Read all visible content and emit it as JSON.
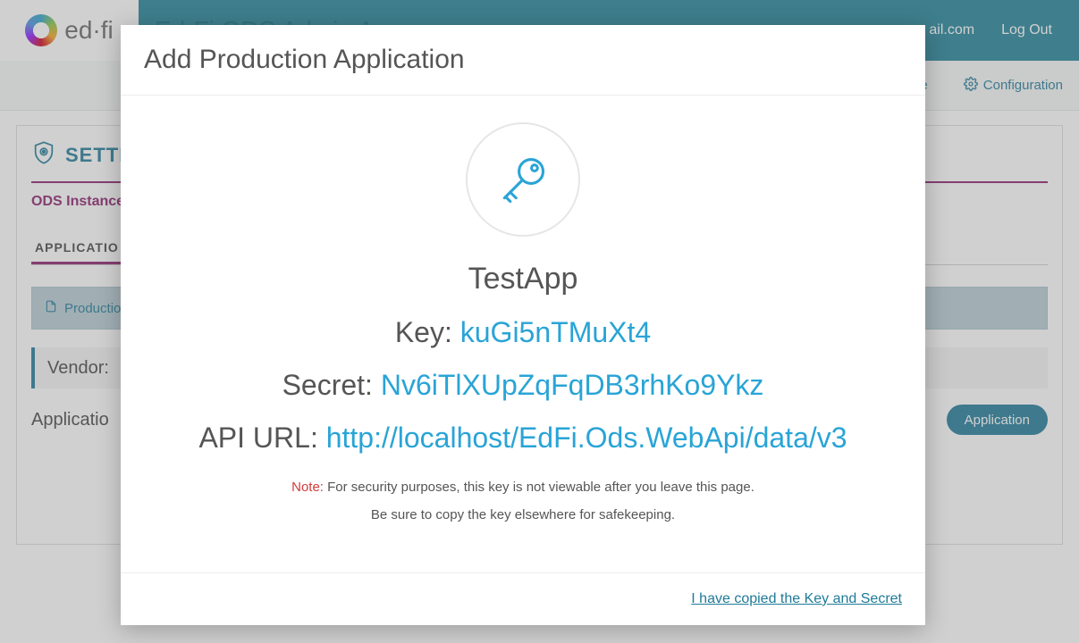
{
  "topbar": {
    "logo_text": "ed·fi",
    "app_title": "Ed-Fi ODS Admin App",
    "user_email_fragment": "ail.com",
    "logout": "Log Out"
  },
  "secondnav": {
    "home_fragment": "e",
    "config": "Configuration"
  },
  "panel": {
    "settings_label": "SETTIN",
    "ods_instance_label": "ODS Instance",
    "tab_label": "APPLICATIO",
    "production_prefix": "Production",
    "vendor_prefix": "Vendor:",
    "applications_prefix": "Applicatio",
    "add_button": "Application"
  },
  "modal": {
    "title": "Add Production Application",
    "app_name": "TestApp",
    "key_label": "Key:",
    "key_value": "kuGi5nTMuXt4",
    "secret_label": "Secret:",
    "secret_value": "Nv6iTlXUpZqFqDB3rhKo9Ykz",
    "api_label": "API URL:",
    "api_value": "http://localhost/EdFi.Ods.WebApi/data/v3",
    "note_label": "Note:",
    "note_text": "For security purposes, this key is not viewable after you leave this page.",
    "note2_text": "Be sure to copy the key elsewhere for safekeeping.",
    "confirm_link": "I have copied the Key and Secret"
  }
}
